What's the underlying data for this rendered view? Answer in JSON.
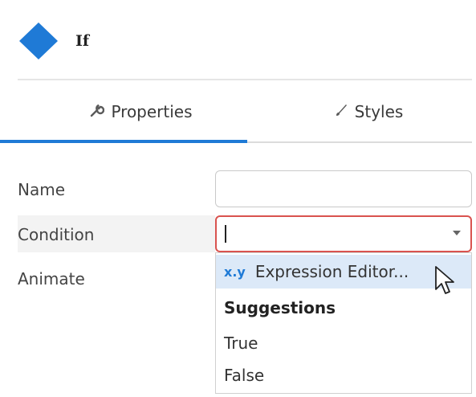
{
  "header": {
    "title": "If",
    "icon": "blue-diamond-icon",
    "accent": "#1f7ad6"
  },
  "tabs": [
    {
      "label": "Properties",
      "icon": "wrench-icon",
      "active": true
    },
    {
      "label": "Styles",
      "icon": "brush-icon",
      "active": false
    }
  ],
  "form": {
    "name_label": "Name",
    "name_value": "",
    "condition_label": "Condition",
    "condition_value": "",
    "animate_label": "Animate"
  },
  "dropdown": {
    "expression_prefix": "x.y",
    "expression_label": "Expression Editor...",
    "suggestions_heading": "Suggestions",
    "options": [
      "True",
      "False"
    ]
  },
  "colors": {
    "error_border": "#d9534f",
    "highlight": "#dce9f8"
  }
}
